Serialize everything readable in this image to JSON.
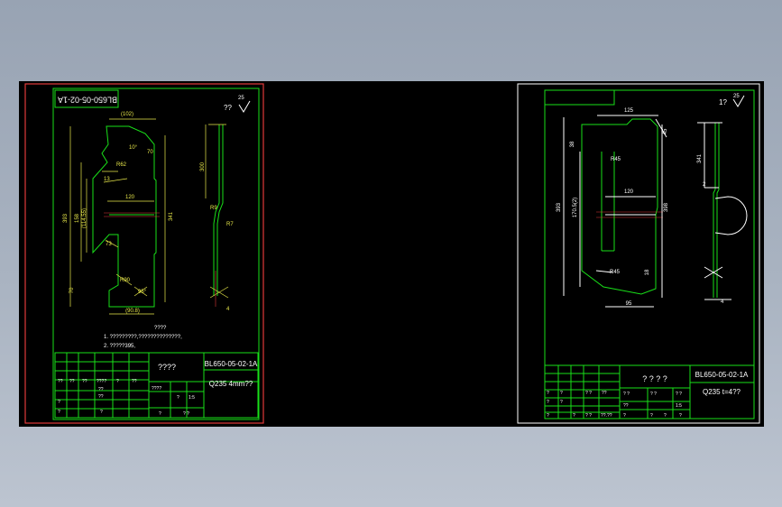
{
  "left_sheet": {
    "drawing_number_rotated": "BL650-05-02-1A",
    "roughness": "??",
    "roughness_value": "25",
    "dims": {
      "top": "(102)",
      "angle_a": "10°",
      "r_top": "R62",
      "d70": "70",
      "d120": "120",
      "d13": "13",
      "left_outer": "393",
      "left_inner": "158",
      "left_inner2": "(114.55)",
      "right_h": "341",
      "d73": "73",
      "d70b": "70",
      "r_bottom": "R90",
      "angle_b": "95°",
      "bottom": "(90.8)",
      "side_top": "300",
      "side_r": "R9",
      "side_r2": "R7",
      "side_d": "4"
    },
    "notes": {
      "heading": "????",
      "line1": "1. ?????????,??????????????,",
      "line2": "2. ?????395,"
    },
    "title_block": {
      "name": "????",
      "drawing_no": "BL650-05-02-1A",
      "material": "Q235  4mm??",
      "cells": [
        "??",
        "??",
        "??",
        "????",
        "?",
        "??",
        "??",
        "??",
        "?",
        "?",
        "?",
        "????",
        "1:5",
        "?",
        "?",
        "? ?"
      ]
    }
  },
  "right_sheet": {
    "roughness": "1?",
    "roughness_value": "25",
    "dims": {
      "top": "125",
      "d45": "45",
      "r1": "R45",
      "d38": "38",
      "left_outer": "393",
      "left_inner": "170.5(2)",
      "right_h": "398",
      "d120": "120",
      "r2": "R45",
      "d18": "18",
      "bottom": "95",
      "side_top": "341",
      "side_d2": "2",
      "side_d": "4"
    },
    "title_block": {
      "name": "? ? ? ?",
      "drawing_no": "BL650-05-02-1A",
      "material": "Q235   t=4??",
      "cells": [
        "?",
        "?",
        "? ?",
        "??",
        "? ?",
        "? ?",
        "? ?",
        "??",
        "1:5",
        "?",
        "?",
        "?",
        "? ?",
        "?",
        "??.??",
        "?",
        "?",
        "?",
        "?"
      ]
    }
  }
}
